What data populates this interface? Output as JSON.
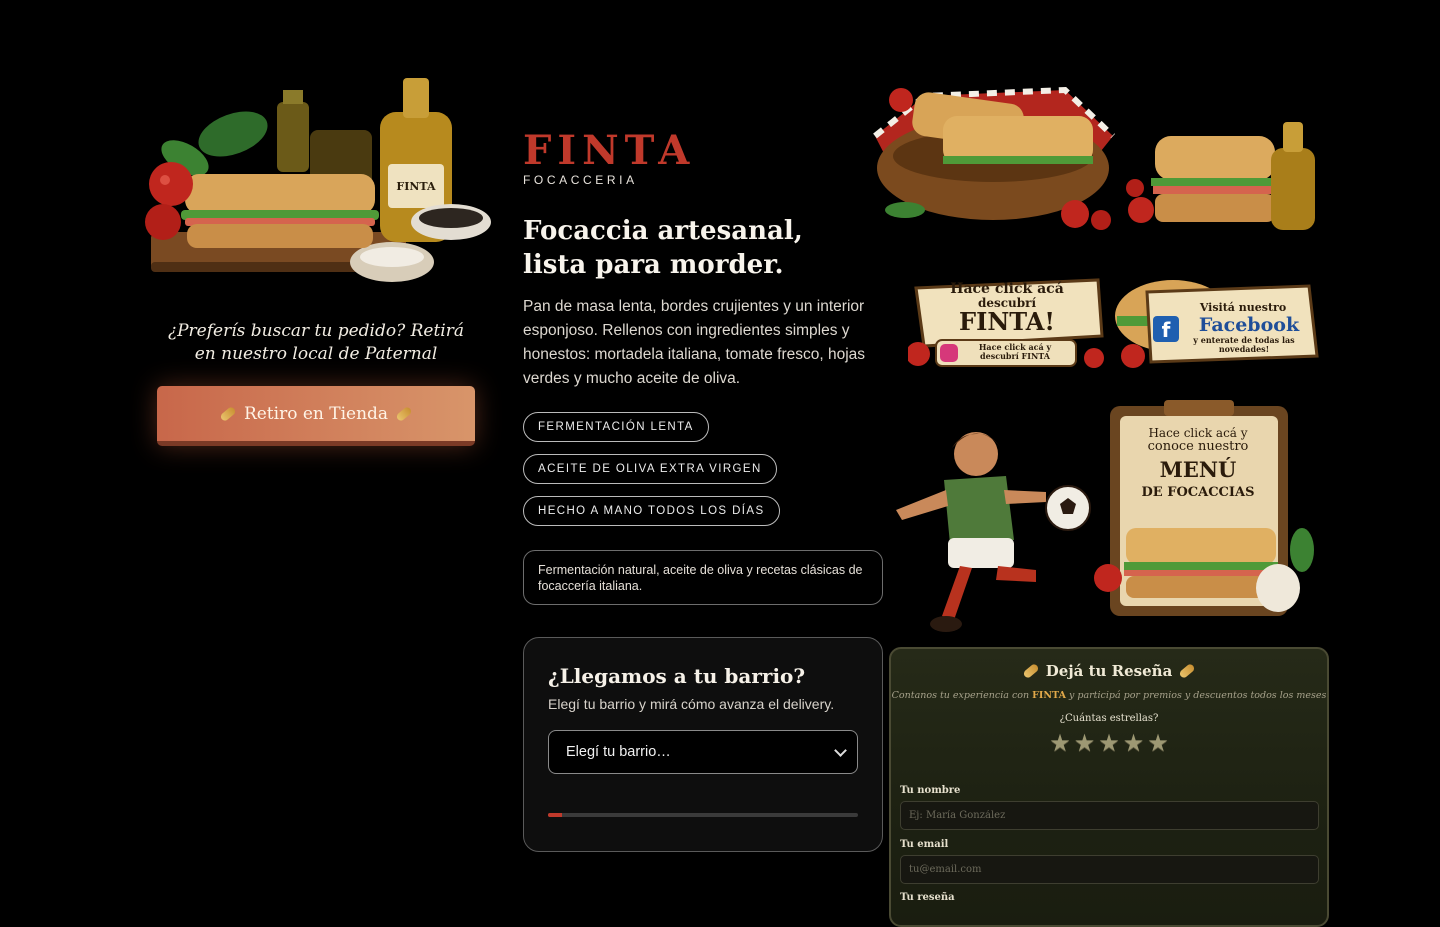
{
  "pickup": {
    "text": "¿Preferís buscar tu pedido? Retirá en nuestro local de Paternal",
    "button_label": "Retiro en Tienda"
  },
  "brand": {
    "name": "FINTA",
    "subtitle": "FOCACCERIA"
  },
  "hero": {
    "headline": "Focaccia artesanal, lista para morder.",
    "intro": "Pan de masa lenta, bordes crujientes y un interior esponjoso. Rellenos con ingredientes simples y honestos: mortadela italiana, tomate fresco, hojas verdes y mucho aceite de oliva."
  },
  "tags": [
    "FERMENTACIÓN LENTA",
    "ACEITE DE OLIVA EXTRA VIRGEN",
    "HECHO A MANO TODOS LOS DÍAS"
  ],
  "note": "Fermentación natural, aceite de oliva y recetas clásicas de focaccería italiana.",
  "barrio": {
    "title": "¿Llegamos a tu barrio?",
    "subtitle": "Elegí tu barrio y mirá cómo avanza el delivery.",
    "select_value": "Elegí tu barrio…",
    "progress": 0.045
  },
  "banners": {
    "illustration_label": "FINTA",
    "instagram": {
      "line1": "Hace click acá",
      "line2": "descubrí",
      "line3": "FINTA!",
      "sub": "Hace click acá y descubrí FINTA"
    },
    "facebook": {
      "line1": "Visitá nuestro",
      "line2": "Facebook",
      "sub": "y enterate de todas las novedades!"
    },
    "menu": {
      "line1": "Hace click acá y",
      "line2": "conoce nuestro",
      "line3": "MENÚ",
      "line4": "DE FOCACCIAS"
    }
  },
  "review": {
    "title": "Dejá tu Reseña",
    "subtitle_before": "Contanos tu experiencia con ",
    "subtitle_brand": "FINTA",
    "subtitle_after": " y participá por premios y descuentos todos los meses",
    "stars_question": "¿Cuántas estrellas?",
    "stars_total": 5,
    "name_label": "Tu nombre",
    "name_placeholder": "Ej: María González",
    "email_label": "Tu email",
    "email_placeholder": "tu@email.com",
    "review_label": "Tu reseña"
  },
  "colors": {
    "brand_red": "#c0392b",
    "button_start": "#c8674a",
    "button_end": "#d8956a",
    "review_bg": "#1d2112"
  }
}
